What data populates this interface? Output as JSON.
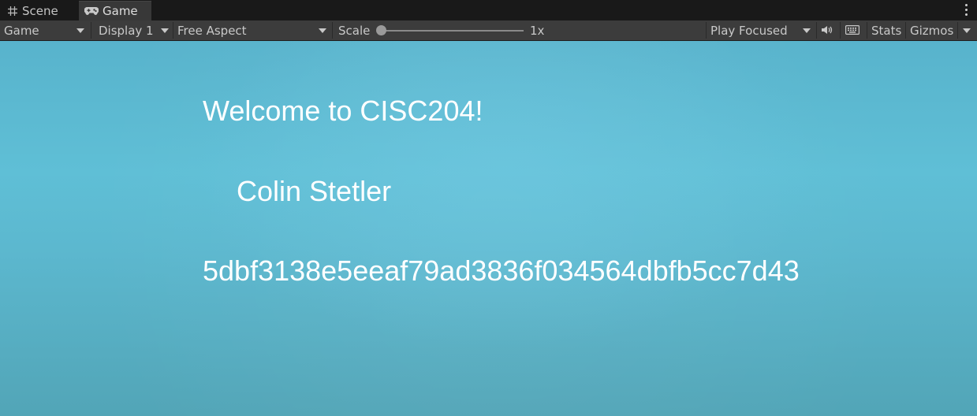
{
  "tabs": {
    "scene": {
      "label": "Scene",
      "icon": "grid-icon"
    },
    "game": {
      "label": "Game",
      "icon": "gamepad-icon",
      "active": true
    }
  },
  "toolbar": {
    "view_mode": "Game",
    "display": "Display 1",
    "aspect": "Free Aspect",
    "scale_label": "Scale",
    "scale_value": "1x",
    "play_mode": "Play Focused",
    "stats_label": "Stats",
    "gizmos_label": "Gizmos"
  },
  "game": {
    "welcome": "Welcome to CISC204!",
    "name": "Colin Stetler",
    "hash": "5dbf3138e5eeaf79ad3836f034564dbfb5cc7d43"
  },
  "colors": {
    "toolbar_bg": "#3c3c3c",
    "tabbar_bg": "#191919",
    "viewport_bg": "#5cb8cf"
  }
}
